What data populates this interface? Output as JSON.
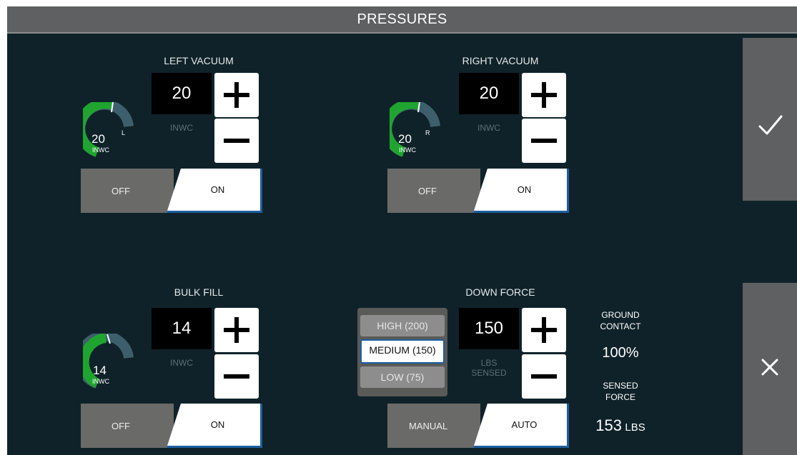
{
  "header": {
    "title": "PRESSURES"
  },
  "left_vacuum": {
    "label": "LEFT VACUUM",
    "value": "20",
    "unit": "INWC",
    "gauge_value": "20",
    "gauge_unit": "INWC",
    "gauge_side": "L",
    "gauge_level": 0.5,
    "toggle_off": "OFF",
    "toggle_on": "ON",
    "state": "ON"
  },
  "right_vacuum": {
    "label": "RIGHT VACUUM",
    "value": "20",
    "unit": "INWC",
    "gauge_value": "20",
    "gauge_unit": "INWC",
    "gauge_side": "R",
    "gauge_level": 0.5,
    "toggle_off": "OFF",
    "toggle_on": "ON",
    "state": "ON"
  },
  "bulk_fill": {
    "label": "BULK FILL",
    "value": "14",
    "unit": "INWC",
    "gauge_value": "14",
    "gauge_unit": "INWC",
    "gauge_level": 0.35,
    "toggle_off": "OFF",
    "toggle_on": "ON",
    "state": "ON"
  },
  "down_force": {
    "label": "DOWN FORCE",
    "value": "150",
    "unit_line1": "LBS",
    "unit_line2": "SENSED",
    "presets": [
      "HIGH (200)",
      "MEDIUM (150)",
      "LOW (75)"
    ],
    "selected_preset": "MEDIUM (150)",
    "toggle_off": "MANUAL",
    "toggle_on": "AUTO",
    "state": "AUTO"
  },
  "status": {
    "ground_contact_line1": "GROUND",
    "ground_contact_line2": "CONTACT",
    "ground_contact_value": "100%",
    "sensed_force_line1": "SENSED",
    "sensed_force_line2": "FORCE",
    "sensed_force_value": "153",
    "sensed_force_unit": "LBS"
  },
  "actions": {
    "confirm": "check-icon",
    "cancel": "close-icon"
  },
  "colors": {
    "background": "#0f2229",
    "accent": "#1d5fa0",
    "gauge_fill": "#1fa52f",
    "gauge_track": "#3d5f6c"
  }
}
